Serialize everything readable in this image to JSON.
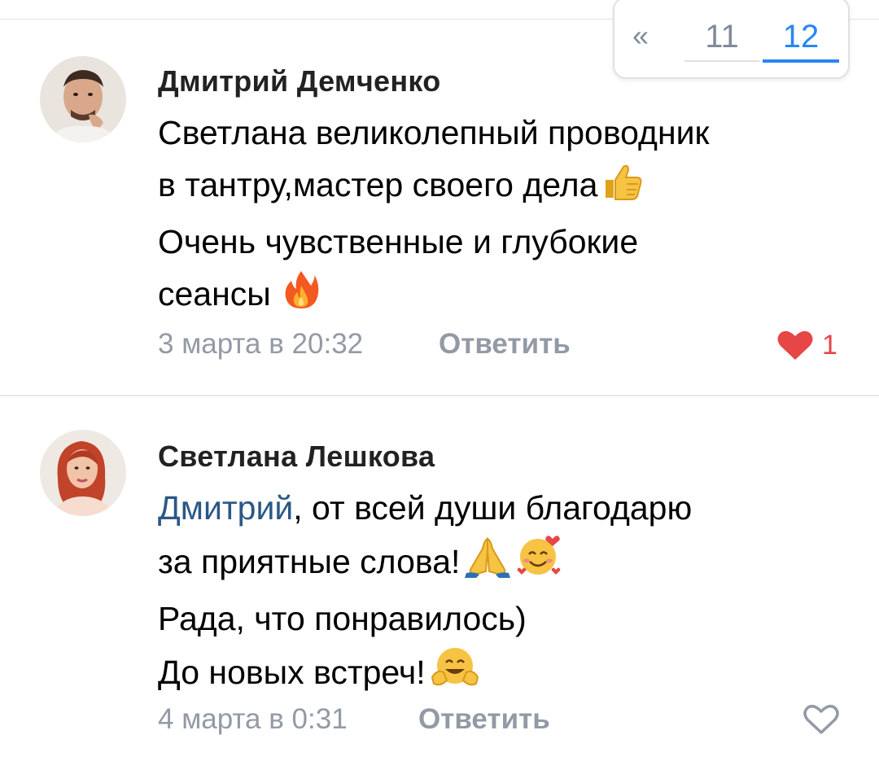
{
  "pagination": {
    "prev_label": "«",
    "pages": [
      "11",
      "12"
    ],
    "current_page": "12"
  },
  "comments": [
    {
      "author": "Дмитрий Демченко",
      "lines": [
        "Светлана великолепный проводник",
        "в тантру,мастер своего дела",
        "Очень чувственные и глубокие",
        "сеансы"
      ],
      "emojis": [
        "thumbs-up",
        "fire"
      ],
      "date": "3 марта в 20:32",
      "reply_label": "Ответить",
      "likes": "1",
      "liked": true
    },
    {
      "author": "Светлана Лешкова",
      "mention": "Дмитрий",
      "lines": [
        ", от всей души благодарю",
        "за приятные слова!",
        "Рада,  что понравилось)",
        "До новых встреч!"
      ],
      "emojis": [
        "folded-hands",
        "smiling-face-with-hearts",
        "hugging-face"
      ],
      "date": "4 марта в 0:31",
      "reply_label": "Ответить",
      "liked": false
    }
  ],
  "colors": {
    "accent": "#2787f5",
    "mention": "#2a5885",
    "meta": "#939aa5",
    "like": "#e64646"
  }
}
